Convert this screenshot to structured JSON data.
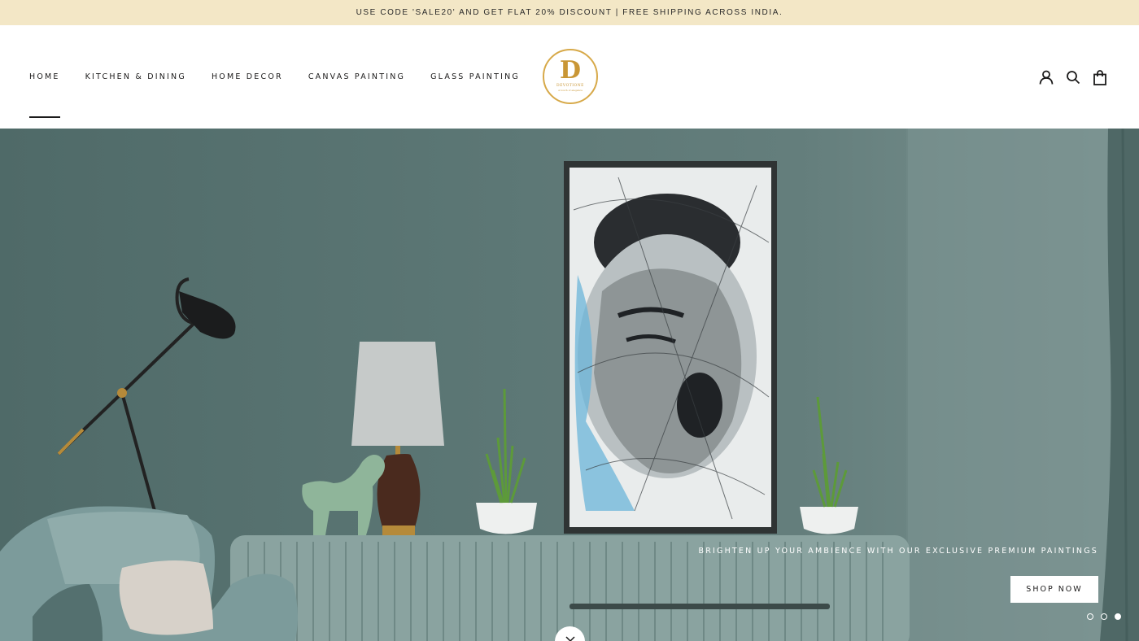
{
  "announcement": {
    "text": "USE CODE 'SALE20' AND GET FLAT 20% DISCOUNT | FREE SHIPPING ACROSS INDIA."
  },
  "nav": {
    "items": [
      {
        "label": "HOME",
        "active": true
      },
      {
        "label": "KITCHEN & DINING",
        "active": false
      },
      {
        "label": "HOME DECOR",
        "active": false
      },
      {
        "label": "CANVAS PAINTING",
        "active": false
      },
      {
        "label": "GLASS PAINTING",
        "active": false
      }
    ]
  },
  "logo": {
    "monogram": "D",
    "brand": "DEVOTIONE",
    "tagline": "A touch of elegance"
  },
  "header_icons": [
    "account-icon",
    "search-icon",
    "cart-icon"
  ],
  "hero": {
    "caption": "BRIGHTEN UP YOUR AMBIENCE WITH OUR EXCLUSIVE PREMIUM PAINTINGS",
    "button_label": "SHOP NOW",
    "slides": 3,
    "active_slide": 3
  },
  "colors": {
    "announcement_bg": "#f3e7c6",
    "brand_gold": "#c99635",
    "wall": "#5b7674",
    "text": "#1c1b1b"
  }
}
